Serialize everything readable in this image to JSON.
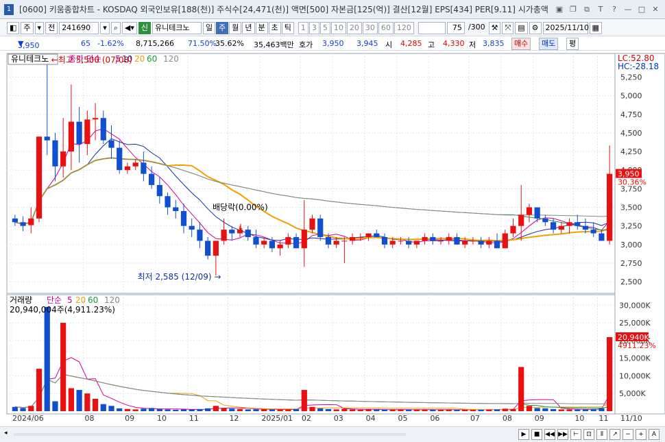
{
  "window": {
    "screen_no": "1",
    "title": "[0600] 키움종합차트 - KOSDAQ 외국인보유[188(천)] 주식수[24,471(천)] 액면[500] 자본금[125(억)] 결산[12월] EPS[434] PER[9.11] 시가총액"
  },
  "toolbar": {
    "type_select": "주",
    "prev_label": "전",
    "code": "241690",
    "name_badge": "신",
    "stock_name": "유니테크노",
    "period_buttons": [
      "일",
      "주",
      "월",
      "년",
      "분",
      "초",
      "틱"
    ],
    "selected_period": "주",
    "interval_buttons": [
      "1",
      "3",
      "5",
      "10",
      "20",
      "30",
      "60",
      "120"
    ],
    "count": "75",
    "count_max": "/300",
    "date": "2025/11/10"
  },
  "quote": {
    "price": "3,950",
    "change": "65",
    "change_pct": "-1.62%",
    "volume": "8,715,266",
    "ratio1": "71.50%",
    "ratio2": "35.62%",
    "amount": "35,463백만",
    "hoga_label": "호가",
    "ask": "3,950",
    "bid": "3,945",
    "open_label": "시",
    "open": "4,285",
    "high_label": "고",
    "high": "4,330",
    "low_label": "저",
    "low": "3,835",
    "buy_label": "매수",
    "sell_label": "매도",
    "flat_label": "평"
  },
  "price_panel": {
    "name": "유니테크노",
    "ma_label": "종가 단순",
    "ma_periods": [
      "5",
      "10",
      "20",
      "60",
      "120"
    ],
    "ma_colors": [
      "#d0009c",
      "#1030a0",
      "#f0a000",
      "#1a9a3a",
      "#888888"
    ],
    "lc": "LC:52.80",
    "hc": "HC:-28.18",
    "high_annotation": "최고 5,500 (07/08)",
    "low_annotation": "최저 2,585 (12/09)",
    "dividend_annotation": "배당락(0.00%)",
    "last_price_tag": "3,950",
    "last_pct_tag": "30.36%",
    "y_ticks": [
      "5,250",
      "5,000",
      "4,750",
      "4,500",
      "4,250",
      "4,000",
      "3,750",
      "3,500",
      "3,250",
      "3,000",
      "2,750",
      "2,500"
    ]
  },
  "volume_panel": {
    "label": "거래량",
    "ma_label": "단순",
    "ma_periods": [
      "5",
      "20",
      "60",
      "120"
    ],
    "info": "20,940,004주(4,911.23%)",
    "last_tag": "20,940K",
    "last_pct_tag": "4911.23%",
    "y_ticks": [
      "30,000K",
      "25,000K",
      "20,000K",
      "15,000K",
      "10,000K",
      "5,000K"
    ]
  },
  "x_labels": [
    "2024/06",
    "08",
    "09",
    "10",
    "11",
    "12",
    "2025/01",
    "02",
    "03",
    "04",
    "05",
    "06",
    "07",
    "08",
    "09",
    "10",
    "11",
    "11/10"
  ],
  "colors": {
    "up": "#e81010",
    "down": "#1050d0",
    "ma5": "#d0009c",
    "ma10": "#1030a0",
    "ma20": "#f0a000",
    "ma60": "#1a9a3a",
    "ma120": "#888888"
  },
  "chart_data": {
    "type": "candlestick",
    "x": [
      "2024/06/03",
      "06/10",
      "06/17",
      "06/24",
      "07/01",
      "07/08",
      "07/15",
      "07/22",
      "07/29",
      "08/05",
      "08/12",
      "08/19",
      "08/26",
      "09/02",
      "09/09",
      "09/16",
      "09/23",
      "09/30",
      "10/07",
      "10/14",
      "10/21",
      "10/28",
      "11/04",
      "11/11",
      "11/18",
      "11/25",
      "12/02",
      "12/09",
      "12/16",
      "12/23",
      "12/30",
      "2025/01/06",
      "01/13",
      "01/20",
      "01/27",
      "02/03",
      "02/10",
      "02/17",
      "02/24",
      "03/03",
      "03/10",
      "03/17",
      "03/24",
      "03/31",
      "04/07",
      "04/14",
      "04/21",
      "04/28",
      "05/05",
      "05/12",
      "05/19",
      "05/26",
      "06/02",
      "06/09",
      "06/16",
      "06/23",
      "06/30",
      "07/07",
      "07/14",
      "07/21",
      "07/28",
      "08/04",
      "08/11",
      "08/18",
      "08/25",
      "09/01",
      "09/08",
      "09/15",
      "09/22",
      "09/29",
      "10/06",
      "10/13",
      "10/20",
      "10/27",
      "11/10"
    ],
    "candles": [
      [
        3350,
        3400,
        3250,
        3300
      ],
      [
        3300,
        3380,
        3180,
        3250
      ],
      [
        3260,
        3500,
        3150,
        3350
      ],
      [
        3350,
        4450,
        3300,
        4450
      ],
      [
        4450,
        5500,
        4200,
        4400
      ],
      [
        4400,
        4500,
        3850,
        4050
      ],
      [
        4050,
        4700,
        3900,
        4250
      ],
      [
        4250,
        5150,
        4000,
        4650
      ],
      [
        4650,
        4850,
        4100,
        4350
      ],
      [
        4350,
        4800,
        4200,
        4680
      ],
      [
        4680,
        4900,
        4400,
        4700
      ],
      [
        4700,
        4800,
        4350,
        4400
      ],
      [
        4400,
        4600,
        4150,
        4300
      ],
      [
        4300,
        4400,
        3950,
        4000
      ],
      [
        4000,
        4100,
        3950,
        4050
      ],
      [
        4050,
        4150,
        4000,
        4100
      ],
      [
        4100,
        4250,
        3850,
        3950
      ],
      [
        3950,
        4050,
        3750,
        3800
      ],
      [
        3800,
        3900,
        3550,
        3650
      ],
      [
        3650,
        3700,
        3400,
        3500
      ],
      [
        3500,
        3600,
        3350,
        3450
      ],
      [
        3450,
        3550,
        3150,
        3250
      ],
      [
        3250,
        3350,
        3100,
        3200
      ],
      [
        3200,
        3300,
        2950,
        3050
      ],
      [
        3050,
        3100,
        2800,
        2850
      ],
      [
        2850,
        3050,
        2585,
        3050
      ],
      [
        3050,
        3350,
        3000,
        3200
      ],
      [
        3200,
        3250,
        3050,
        3150
      ],
      [
        3150,
        3250,
        3100,
        3200
      ],
      [
        3200,
        3250,
        3050,
        3100
      ],
      [
        3100,
        3200,
        2950,
        3000
      ],
      [
        3000,
        3100,
        2950,
        3050
      ],
      [
        3050,
        3100,
        2900,
        2950
      ],
      [
        2950,
        3050,
        2850,
        3000
      ],
      [
        3000,
        3150,
        2950,
        3100
      ],
      [
        3100,
        3150,
        2950,
        2950
      ],
      [
        2950,
        3600,
        2700,
        3200
      ],
      [
        3200,
        3400,
        3150,
        3350
      ],
      [
        3350,
        3400,
        3050,
        3100
      ],
      [
        3100,
        3150,
        2950,
        3000
      ],
      [
        3000,
        3100,
        2950,
        3050
      ],
      [
        3050,
        3100,
        2750,
        3050
      ],
      [
        3050,
        3150,
        3000,
        3100
      ],
      [
        3100,
        3150,
        3050,
        3100
      ],
      [
        3100,
        3150,
        3050,
        3150
      ],
      [
        3150,
        3200,
        3100,
        3100
      ],
      [
        3100,
        3150,
        2950,
        3000
      ],
      [
        3000,
        3100,
        2950,
        3050
      ],
      [
        3050,
        3100,
        3000,
        3050
      ],
      [
        3050,
        3100,
        2950,
        3000
      ],
      [
        3000,
        3050,
        2950,
        3050
      ],
      [
        3050,
        3150,
        3000,
        3100
      ],
      [
        3100,
        3150,
        3000,
        3050
      ],
      [
        3050,
        3100,
        3000,
        3050
      ],
      [
        3050,
        3150,
        3000,
        3100
      ],
      [
        3100,
        3150,
        3000,
        3000
      ],
      [
        3000,
        3100,
        2950,
        3050
      ],
      [
        3050,
        3100,
        3000,
        3050
      ],
      [
        3050,
        3100,
        2950,
        3000
      ],
      [
        3000,
        3100,
        2950,
        3050
      ],
      [
        3050,
        3150,
        2950,
        2950
      ],
      [
        2950,
        3200,
        2950,
        3150
      ],
      [
        3150,
        3350,
        3100,
        3250
      ],
      [
        3250,
        3800,
        3050,
        3400
      ],
      [
        3400,
        3550,
        3300,
        3500
      ],
      [
        3500,
        3450,
        3300,
        3350
      ],
      [
        3350,
        3400,
        3250,
        3300
      ],
      [
        3300,
        3350,
        3150,
        3200
      ],
      [
        3200,
        3300,
        3150,
        3250
      ],
      [
        3250,
        3350,
        3150,
        3300
      ],
      [
        3300,
        3400,
        3200,
        3250
      ],
      [
        3250,
        3350,
        3150,
        3200
      ],
      [
        3200,
        3300,
        3100,
        3150
      ],
      [
        3150,
        3200,
        3050,
        3050
      ],
      [
        3050,
        4330,
        3000,
        3950
      ]
    ],
    "volume_k": [
      1200,
      900,
      1500,
      12000,
      29500,
      2800,
      25000,
      6500,
      6000,
      5000,
      3500,
      2000,
      1500,
      800,
      600,
      500,
      700,
      900,
      600,
      500,
      400,
      500,
      450,
      600,
      800,
      1500,
      900,
      700,
      600,
      500,
      550,
      500,
      450,
      400,
      500,
      600,
      6000,
      1200,
      800,
      600,
      500,
      700,
      500,
      400,
      500,
      450,
      400,
      500,
      450,
      400,
      420,
      450,
      400,
      380,
      450,
      400,
      420,
      400,
      380,
      450,
      500,
      700,
      600,
      12500,
      1500,
      900,
      800,
      600,
      500,
      500,
      450,
      500,
      600,
      800,
      20940
    ]
  }
}
